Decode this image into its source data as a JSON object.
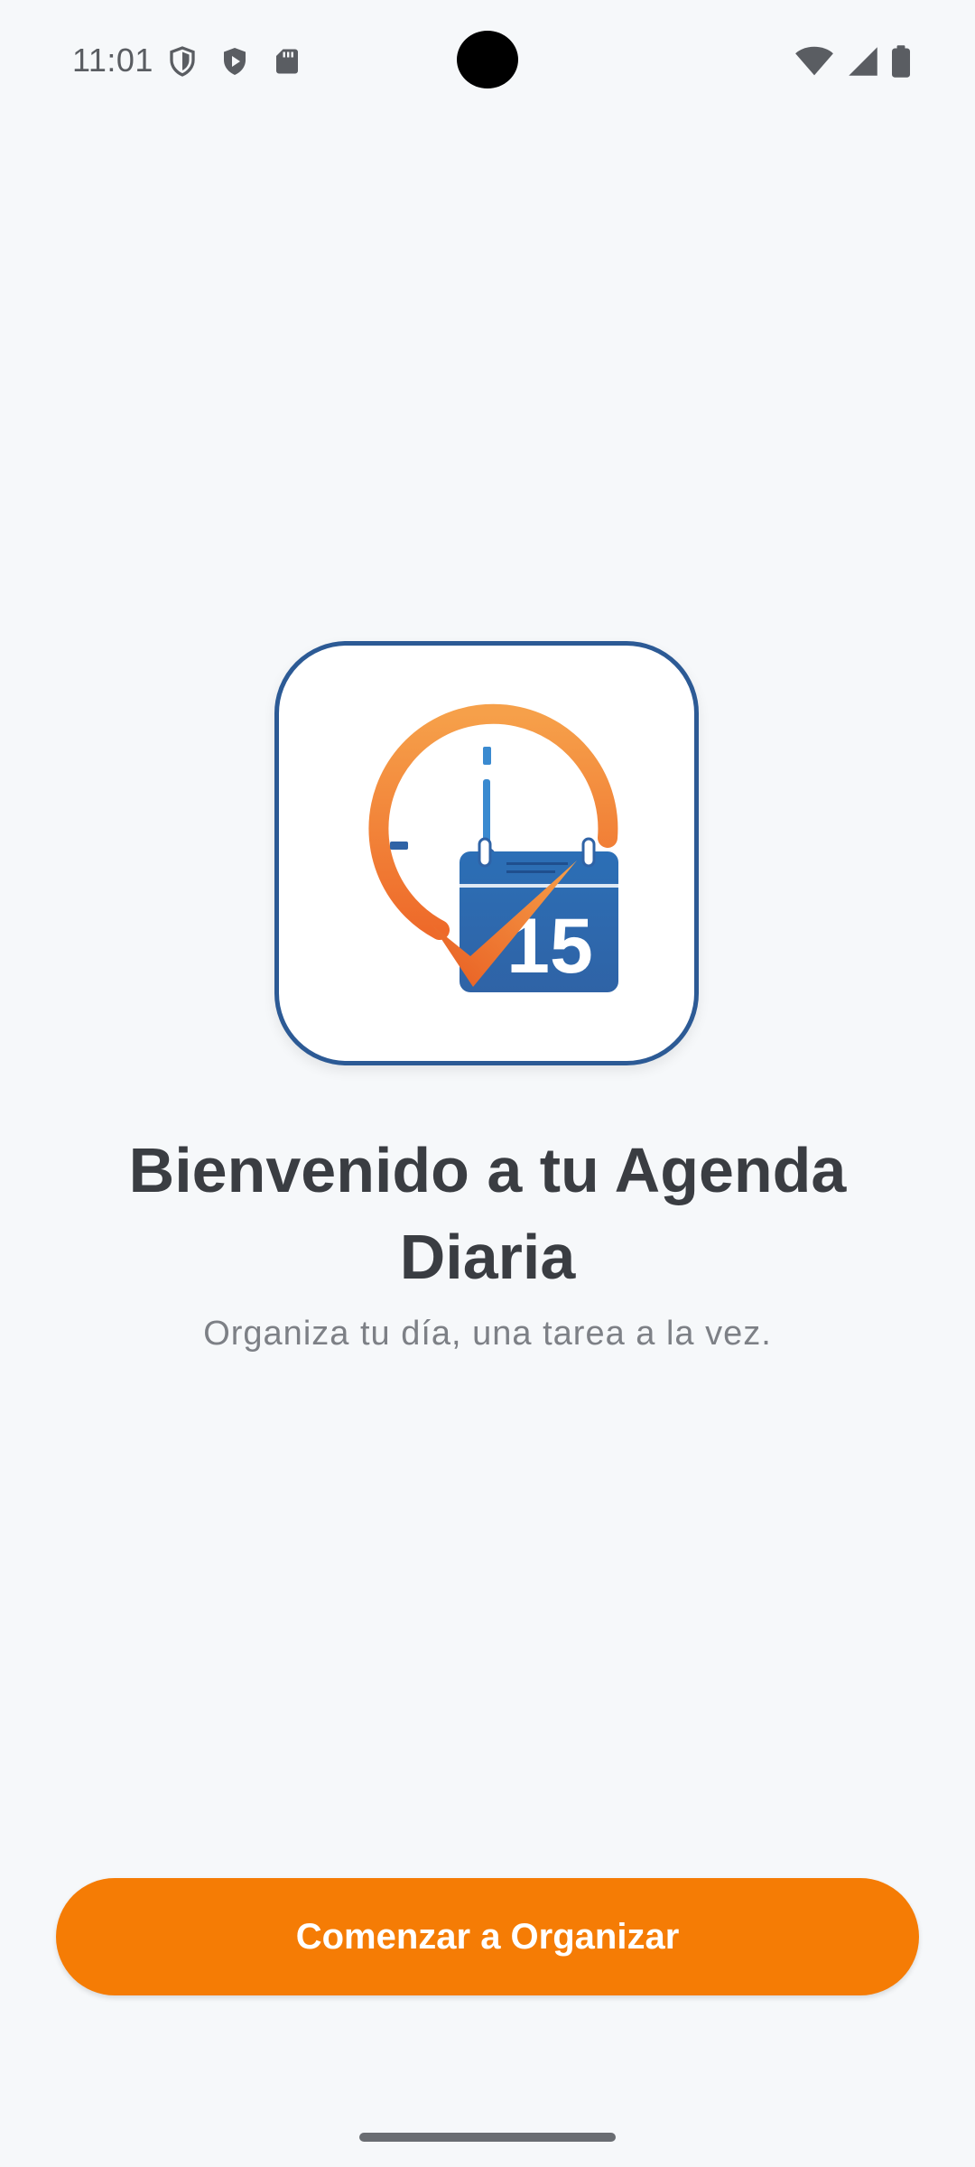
{
  "status_bar": {
    "time": "11:01",
    "left_icons": [
      "vpn-shield-icon",
      "play-protect-icon",
      "sd-card-icon"
    ],
    "right_icons": [
      "wifi-icon",
      "signal-icon",
      "battery-icon"
    ]
  },
  "logo": {
    "calendar_day": "15",
    "colors": {
      "border": "#2c5a95",
      "orange": "#f5892e",
      "blue": "#2c6fb6"
    }
  },
  "welcome": {
    "title": "Bienvenido a tu Agenda Diaria",
    "subtitle": "Organiza tu día, una tarea a la vez."
  },
  "cta": {
    "label": "Comenzar a Organizar",
    "color": "#f57c05"
  }
}
